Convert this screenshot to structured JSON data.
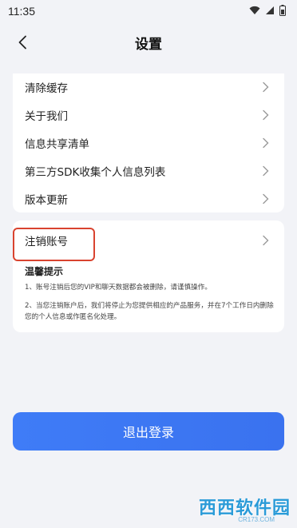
{
  "status_bar": {
    "time": "11:35",
    "icons": [
      "wifi-icon",
      "signal-icon",
      "battery-icon"
    ]
  },
  "nav": {
    "title": "设置",
    "back_icon": "chevron-left-icon"
  },
  "menu": {
    "items": [
      {
        "label": "清除缓存"
      },
      {
        "label": "关于我们"
      },
      {
        "label": "信息共享清单"
      },
      {
        "label": "第三方SDK收集个人信息列表"
      },
      {
        "label": "版本更新"
      }
    ]
  },
  "account": {
    "cancel_label": "注销账号",
    "tips_title": "温馨提示",
    "tip1": "1、账号注销后您的VIP和聊天数据都会被删除，请谨慎操作。",
    "tip2": "2、当您注销账户后，我们将停止为您提供相应的产品服务，并在7个工作日内删除您的个人信息或作匿名化处理。"
  },
  "logout_label": "退出登录",
  "watermark": {
    "main": "西西软件园",
    "sub": "CR173.COM"
  },
  "colors": {
    "primary": "#3f7cf7",
    "highlight": "#d9432f",
    "background": "#f2f3f7"
  }
}
